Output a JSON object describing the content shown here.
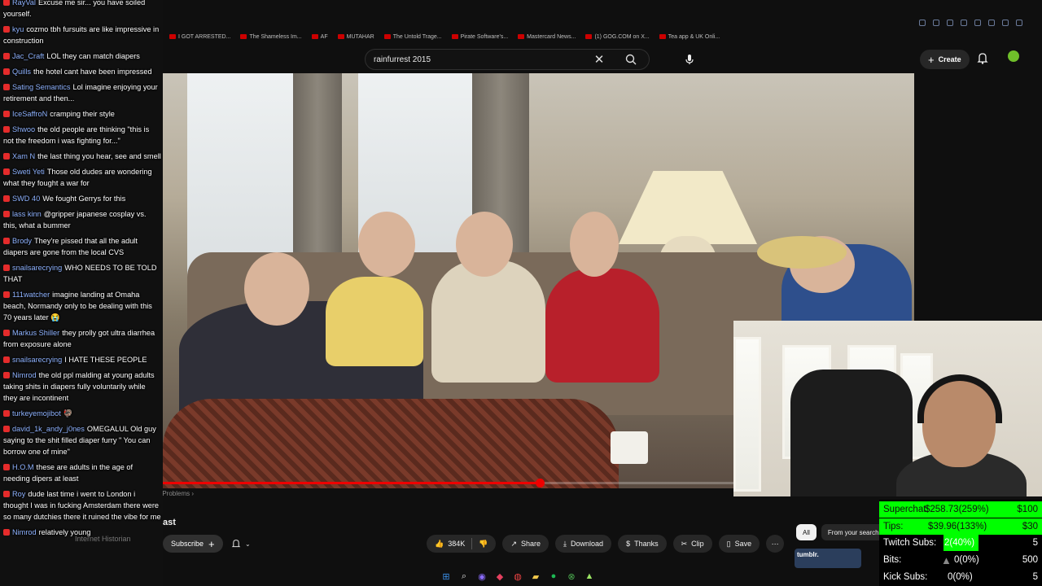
{
  "browser": {
    "bookmarks": [
      "I GOT ARRESTED...",
      "The Shameless Im...",
      "AF",
      "MUTAHAR",
      "The Untold Trage...",
      "Pirate Software's...",
      "Mastercard News...",
      "(1) GOG.COM on X...",
      "Tea app & UK Onli..."
    ]
  },
  "youtube": {
    "search_value": "rainfurrest 2015",
    "create_label": "Create",
    "video_title": "ast",
    "channel_name": "Internet Historian",
    "subscribe_label": "Subscribe",
    "chapter_label": "Problems",
    "likes": "384K",
    "actions": {
      "share": "Share",
      "download": "Download",
      "thanks": "Thanks",
      "clip": "Clip",
      "save": "Save"
    },
    "filter_chips": [
      "All",
      "From your search"
    ],
    "tumblr_label": "tumblr.",
    "progress": 0.502
  },
  "chat": [
    {
      "user": "RayVal",
      "color": "#8fb3ff",
      "text": "Excuse me sir... you have soiled yourself."
    },
    {
      "user": "kyu",
      "color": "#8fb3ff",
      "text": "cozmo tbh fursuits are like impressive in construction"
    },
    {
      "user": "Jac_Craft",
      "color": "#8fb3ff",
      "text": "LOL they can match diapers"
    },
    {
      "user": "Quills",
      "color": "#8fb3ff",
      "text": "the hotel cant have been impressed"
    },
    {
      "user": "Sating Semantics",
      "color": "#8fb3ff",
      "text": "Lol imagine enjoying your retirement and then..."
    },
    {
      "user": "IceSaffroN",
      "color": "#8fb3ff",
      "text": "cramping their style"
    },
    {
      "user": "Shwoo",
      "color": "#8fb3ff",
      "text": "the old people are thinking \"this is not the freedom i was fighting for...\""
    },
    {
      "user": "Xam N",
      "color": "#8fb3ff",
      "text": "the last thing you hear, see and smell"
    },
    {
      "user": "Sweti Yeti",
      "color": "#8fb3ff",
      "text": "Those old dudes are wondering what they fought a war for"
    },
    {
      "user": "SWD 40",
      "color": "#8fb3ff",
      "text": "We fought Gerrys for this"
    },
    {
      "user": "lass kinn",
      "color": "#8fb3ff",
      "text": "@gripper japanese cosplay vs. this, what a bummer"
    },
    {
      "user": "Brody",
      "color": "#8fb3ff",
      "text": "They're pissed that all the adult diapers are gone from the local CVS"
    },
    {
      "user": "snailsarecrying",
      "color": "#8fb3ff",
      "text": "WHO NEEDS TO BE TOLD THAT"
    },
    {
      "user": "111watcher",
      "color": "#8fb3ff",
      "text": "imagine landing at Omaha beach, Normandy only to be dealing with this 70 years later 😭"
    },
    {
      "user": "Markus Shiller",
      "color": "#8fb3ff",
      "text": "they prolly got ultra diarrhea from exposure alone"
    },
    {
      "user": "snailsarecrying",
      "color": "#8fb3ff",
      "text": "I HATE THESE PEOPLE"
    },
    {
      "user": "Nimrod",
      "color": "#8fb3ff",
      "text": "the old ppl malding at young adults taking shits in diapers fully voluntarily while they are incontinent"
    },
    {
      "user": "turkeyemojibot",
      "color": "#8fb3ff",
      "text": "🦃"
    },
    {
      "user": "david_1k_andy_j0nes",
      "color": "#8fb3ff",
      "text": "OMEGALUL Old guy saying to the shit filled diaper furry \" You can borrow one of mine\""
    },
    {
      "user": "H.O.M",
      "color": "#8fb3ff",
      "text": "these are adults in the age of needing dipers at least"
    },
    {
      "user": "Roy",
      "color": "#8fb3ff",
      "text": "dude last time i went to London i thought I was in fucking Amsterdam there were so many dutchies there it ruined the vibe for me"
    },
    {
      "user": "Nimrod",
      "color": "#8fb3ff",
      "text": "relatively young"
    }
  ],
  "stats": {
    "superchat": {
      "label": "Superchat:",
      "value": "$258.73(259%)",
      "goal": "$100"
    },
    "tips": {
      "label": "Tips:",
      "value": "$39.96(133%)",
      "goal": "$30"
    },
    "twitch": {
      "label": "Twitch Subs:",
      "value": "2(40%)",
      "goal": "5"
    },
    "bits": {
      "label": "Bits:",
      "value": "0(0%)",
      "goal": "500"
    },
    "kick": {
      "label": "Kick Subs:",
      "value": "0(0%)",
      "goal": "5"
    }
  }
}
